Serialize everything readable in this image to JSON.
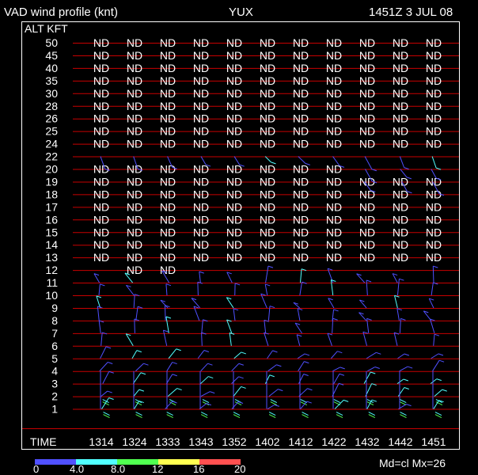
{
  "header": {
    "title": "VAD wind profile (knt)",
    "station": "YUX",
    "datetime": "1451Z  3 JUL 08"
  },
  "axis": {
    "y_title": "ALT KFT",
    "x_title": "TIME"
  },
  "altitudes": [
    "50",
    "45",
    "40",
    "35",
    "30",
    "28",
    "26",
    "25",
    "24",
    "22",
    "20",
    "19",
    "18",
    "17",
    "16",
    "15",
    "14",
    "13",
    "12",
    "11",
    "10",
    "9",
    "8",
    "7",
    "6",
    "5",
    "4",
    "3",
    "2",
    "1"
  ],
  "times": [
    "1314",
    "1324",
    "1333",
    "1343",
    "1352",
    "1402",
    "1412",
    "1422",
    "1432",
    "1442",
    "1451"
  ],
  "nd_text": "ND",
  "nd_cells": {
    "50": [
      0,
      1,
      2,
      3,
      4,
      5,
      6,
      7,
      8,
      9,
      10
    ],
    "45": [
      0,
      1,
      2,
      3,
      4,
      5,
      6,
      7,
      8,
      9,
      10
    ],
    "40": [
      0,
      1,
      2,
      3,
      4,
      5,
      6,
      7,
      8,
      9,
      10
    ],
    "35": [
      0,
      1,
      2,
      3,
      4,
      5,
      6,
      7,
      8,
      9,
      10
    ],
    "30": [
      0,
      1,
      2,
      3,
      4,
      5,
      6,
      7,
      8,
      9,
      10
    ],
    "28": [
      0,
      1,
      2,
      3,
      4,
      5,
      6,
      7,
      8,
      9,
      10
    ],
    "26": [
      0,
      1,
      2,
      3,
      4,
      5,
      6,
      7,
      8,
      9,
      10
    ],
    "25": [
      0,
      1,
      2,
      3,
      4,
      5,
      6,
      7,
      8,
      9,
      10
    ],
    "24": [
      0,
      1,
      2,
      3,
      4,
      5,
      6,
      7,
      8,
      9,
      10
    ],
    "20": [
      0,
      1,
      2,
      3,
      4,
      5,
      6,
      7
    ],
    "19": [
      0,
      1,
      2,
      3,
      4,
      5,
      6,
      7,
      8,
      9,
      10
    ],
    "18": [
      0,
      1,
      2,
      3,
      4,
      5,
      6,
      7,
      8,
      9,
      10
    ],
    "17": [
      0,
      1,
      2,
      3,
      4,
      5,
      6,
      7,
      8,
      9,
      10
    ],
    "16": [
      0,
      1,
      2,
      3,
      4,
      5,
      6,
      7,
      8,
      9,
      10
    ],
    "15": [
      0,
      1,
      2,
      3,
      4,
      5,
      6,
      7,
      8,
      9,
      10
    ],
    "14": [
      0,
      1,
      2,
      3,
      4,
      5,
      6,
      7,
      8,
      9,
      10
    ],
    "13": [
      0,
      1,
      2,
      3,
      4,
      5,
      6,
      7,
      8,
      9,
      10
    ],
    "12": [
      1,
      2
    ]
  },
  "wind_rows": [
    "22",
    "20",
    "19",
    "11",
    "10",
    "9",
    "8",
    "7",
    "6",
    "5",
    "4",
    "3",
    "2",
    "1"
  ],
  "footer": {
    "mode": "Md=cl Mx=26"
  },
  "legend": {
    "labels": [
      "0",
      "4.0",
      "8.0",
      "12",
      "16",
      "20"
    ],
    "colors": [
      "#5050ff",
      "#50ffff",
      "#50ff50",
      "#ffff50",
      "#ff5050"
    ]
  },
  "colors": {
    "grid": "#c80000",
    "frame": "#ffffff",
    "text": "#ffffff"
  }
}
